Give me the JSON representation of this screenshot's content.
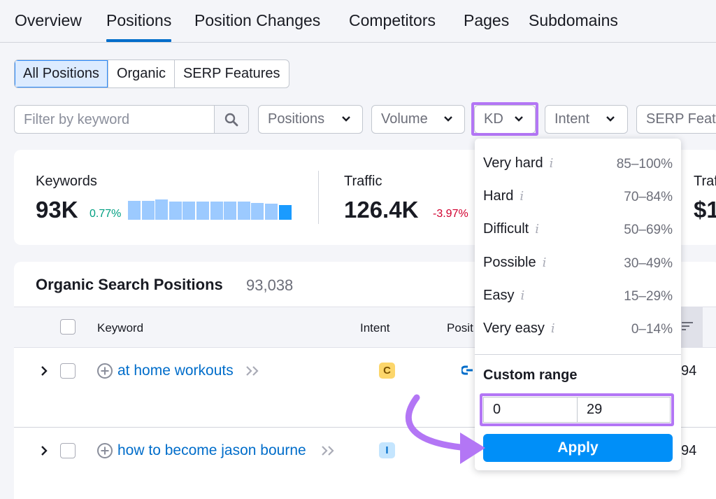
{
  "nav": {
    "tabs": [
      {
        "label": "Overview"
      },
      {
        "label": "Positions",
        "active": true
      },
      {
        "label": "Position Changes"
      },
      {
        "label": "Competitors"
      },
      {
        "label": "Pages"
      },
      {
        "label": "Subdomains"
      }
    ]
  },
  "segment": {
    "items": [
      {
        "label": "All Positions",
        "active": true
      },
      {
        "label": "Organic"
      },
      {
        "label": "SERP Features"
      }
    ]
  },
  "filters": {
    "search_placeholder": "Filter by keyword",
    "positions_label": "Positions",
    "volume_label": "Volume",
    "kd_label": "KD",
    "intent_label": "Intent",
    "serp_label": "SERP Featu"
  },
  "summary": {
    "keywords": {
      "label": "Keywords",
      "value": "93K",
      "delta": "0.77%",
      "bars": [
        0.9,
        0.9,
        0.95,
        0.85,
        0.85,
        0.85,
        0.85,
        0.85,
        0.85,
        0.8,
        0.75,
        0.7
      ]
    },
    "traffic": {
      "label": "Traffic",
      "value": "126.4K",
      "delta": "-3.97%"
    },
    "traffic_cost": {
      "label": "Traf",
      "value": "$1"
    }
  },
  "table": {
    "title": "Organic Search Positions",
    "count": "93,038",
    "headers": {
      "keyword": "Keyword",
      "intent": "Intent",
      "position": "Posit"
    },
    "rows": [
      {
        "keyword": "at home workouts",
        "intent": "C",
        "cut": "94"
      },
      {
        "keyword": "how to become jason bourne",
        "intent": "I",
        "cut": "94"
      }
    ]
  },
  "kd_menu": {
    "items": [
      {
        "label": "Very hard",
        "range": "85–100%"
      },
      {
        "label": "Hard",
        "range": "70–84%"
      },
      {
        "label": "Difficult",
        "range": "50–69%"
      },
      {
        "label": "Possible",
        "range": "30–49%"
      },
      {
        "label": "Easy",
        "range": "15–29%"
      },
      {
        "label": "Very easy",
        "range": "0–14%"
      }
    ],
    "custom_title": "Custom range",
    "from_value": "0",
    "to_value": "29",
    "apply_label": "Apply"
  },
  "colors": {
    "accent": "#006dca",
    "apply": "#008ff8",
    "highlight": "#b376f5",
    "positive": "#009f81",
    "negative": "#d1002f"
  }
}
